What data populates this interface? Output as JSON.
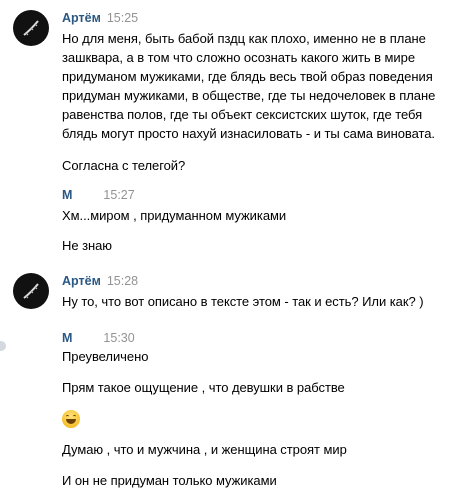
{
  "messages": [
    {
      "author": "Артём",
      "time": "15:25",
      "lines": [
        "Но для меня, быть бабой пздц как плохо, именно не в плане",
        "зашквара, а в том что сложно осознать какого жить в мире",
        "придуманом мужиками, где блядь весь твой образ поведения",
        "придуман мужиками, в обществе, где ты недочеловек в плане",
        "равенства полов, где ты объект сексистских шуток, где тебя",
        "блядь могут просто нахуй изнасиловать - и ты сама виновата."
      ],
      "followup": "Согласна с телегой?"
    },
    {
      "author": "М",
      "time": "15:27",
      "lines": [
        "Хм...миром , придуманном мужиками"
      ],
      "followup": "Не знаю"
    },
    {
      "author": "Артём",
      "time": "15:28",
      "lines": [
        "Ну то, что вот описано в тексте этом - так и есть? Или как? )"
      ]
    },
    {
      "author": "М",
      "time": "15:30",
      "lines": [
        "Преувеличено",
        "Прям такое ощущение , что девушки в рабстве",
        "Думаю , что и мужчина , и женщина строят мир",
        "И он не придуман только мужиками"
      ],
      "emoji": "grinning-face-emoji"
    }
  ],
  "colors": {
    "author": "#2a5885",
    "time": "#939393",
    "text": "#000000"
  }
}
